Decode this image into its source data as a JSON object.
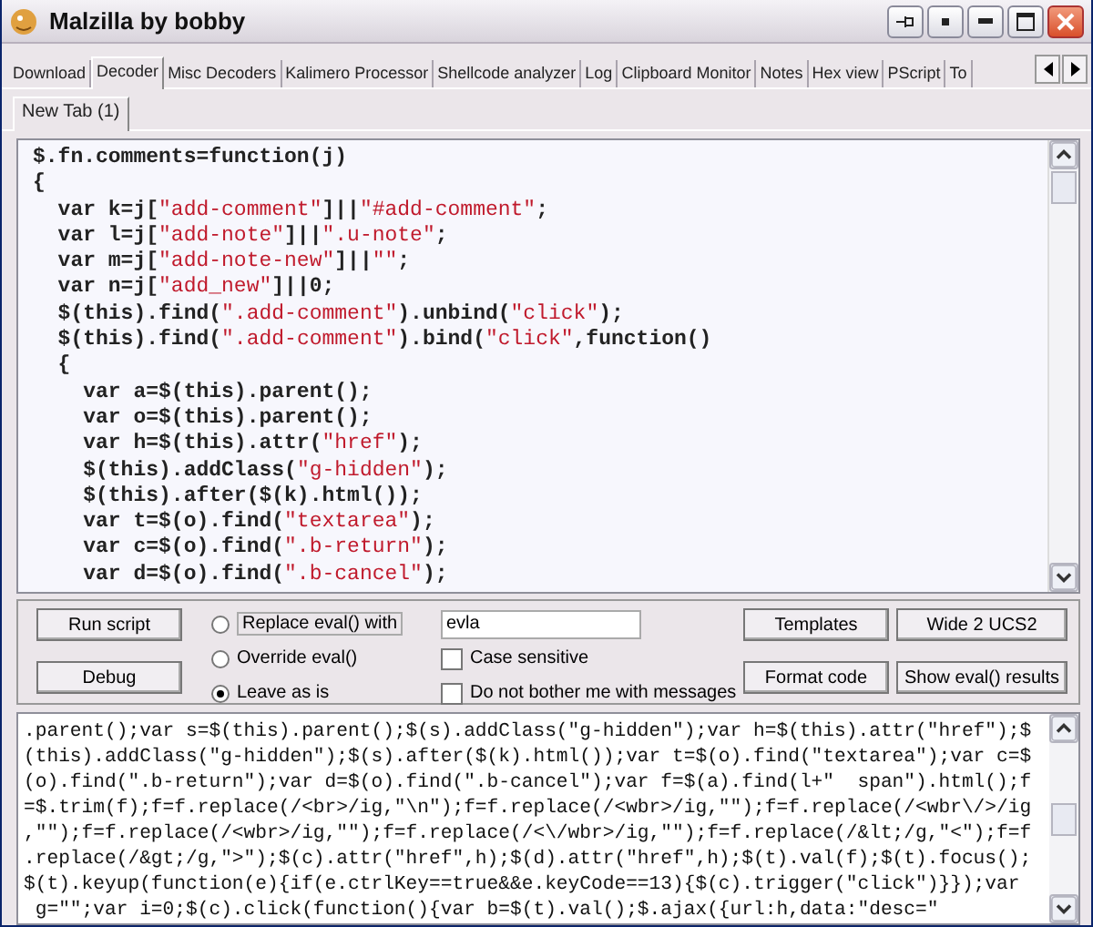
{
  "window": {
    "title": "Malzilla by bobby"
  },
  "tabs": [
    {
      "label": "Download",
      "selected": false
    },
    {
      "label": "Decoder",
      "selected": true
    },
    {
      "label": "Misc Decoders",
      "selected": false
    },
    {
      "label": "Kalimero Processor",
      "selected": false
    },
    {
      "label": "Shellcode analyzer",
      "selected": false
    },
    {
      "label": "Log",
      "selected": false
    },
    {
      "label": "Clipboard Monitor",
      "selected": false
    },
    {
      "label": "Notes",
      "selected": false
    },
    {
      "label": "Hex view",
      "selected": false
    },
    {
      "label": "PScript",
      "selected": false
    },
    {
      "label": "To",
      "selected": false
    }
  ],
  "subtabs": [
    {
      "label": "New Tab (1)",
      "selected": true
    }
  ],
  "editor": {
    "lines": [
      "$.fn.comments=function(j)",
      "{",
      "  var k=j[\"add-comment\"]||\"#add-comment\";",
      "  var l=j[\"add-note\"]||\".u-note\";",
      "  var m=j[\"add-note-new\"]||\"\";",
      "  var n=j[\"add_new\"]||0;",
      "  $(this).find(\".add-comment\").unbind(\"click\");",
      "  $(this).find(\".add-comment\").bind(\"click\",function()",
      "  {",
      "    var a=$(this).parent();",
      "    var o=$(this).parent();",
      "    var h=$(this).attr(\"href\");",
      "    $(this).addClass(\"g-hidden\");",
      "    $(this).after($(k).html());",
      "    var t=$(o).find(\"textarea\");",
      "    var c=$(o).find(\".b-return\");",
      "    var d=$(o).find(\".b-cancel\");"
    ]
  },
  "controls": {
    "run_button": "Run script",
    "debug_button": "Debug",
    "radios": [
      {
        "label": "Replace eval() with",
        "selected": false
      },
      {
        "label": "Override eval()",
        "selected": false
      },
      {
        "label": "Leave as is",
        "selected": true
      }
    ],
    "replace_value": "evla",
    "checkboxes": [
      {
        "label": "Case sensitive",
        "checked": false
      },
      {
        "label": "Do not bother me with messages",
        "checked": false
      }
    ],
    "templates_button": "Templates",
    "format_button": "Format code",
    "wide_button": "Wide 2 UCS2",
    "show_eval_button": "Show eval() results"
  },
  "output": {
    "lines": [
      ".parent();var s=$(this).parent();$(s).addClass(\"g-hidden\");var h=$(this).attr(\"href\");$",
      "(this).addClass(\"g-hidden\");$(s).after($(k).html());var t=$(o).find(\"textarea\");var c=$",
      "(o).find(\".b-return\");var d=$(o).find(\".b-cancel\");var f=$(a).find(l+\"  span\").html();f",
      "=$.trim(f);f=f.replace(/<br>/ig,\"\\n\");f=f.replace(/<wbr>/ig,\"\");f=f.replace(/<wbr\\/>/ig",
      ",\"\");f=f.replace(/<wbr>/ig,\"\");f=f.replace(/<\\/wbr>/ig,\"\");f=f.replace(/&lt;/g,\"<\");f=f",
      ".replace(/&gt;/g,\">\");$(c).attr(\"href\",h);$(d).attr(\"href\",h);$(t).val(f);$(t).focus();",
      "$(t).keyup(function(e){if(e.ctrlKey==true&&e.keyCode==13){$(c).trigger(\"click\")}});var",
      " g=\"\";var i=0;$(c).click(function(){var b=$(t).val();$.ajax({url:h,data:\"desc=\""
    ]
  }
}
